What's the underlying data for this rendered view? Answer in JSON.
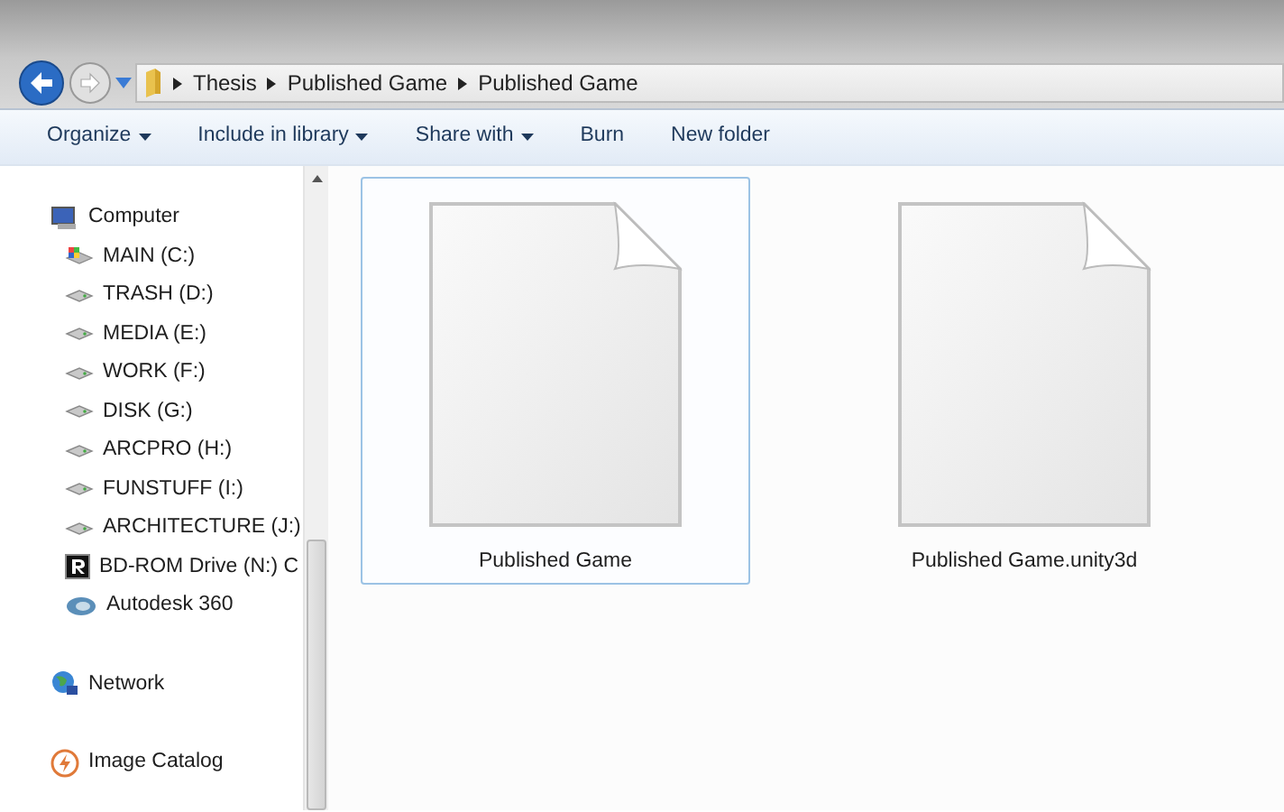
{
  "breadcrumb": {
    "segments": [
      "Thesis",
      "Published Game",
      "Published Game"
    ]
  },
  "toolbar": [
    {
      "label": "Organize",
      "dropdown": true
    },
    {
      "label": "Include in library",
      "dropdown": true
    },
    {
      "label": "Share with",
      "dropdown": true
    },
    {
      "label": "Burn",
      "dropdown": false
    },
    {
      "label": "New folder",
      "dropdown": false
    }
  ],
  "sidebar": {
    "items": [
      {
        "label": "Computer",
        "kind": "computer",
        "children": [
          {
            "label": "MAIN (C:)",
            "kind": "system-drive"
          },
          {
            "label": "TRASH (D:)",
            "kind": "drive"
          },
          {
            "label": "MEDIA (E:)",
            "kind": "drive"
          },
          {
            "label": "WORK (F:)",
            "kind": "drive"
          },
          {
            "label": "DISK (G:)",
            "kind": "drive"
          },
          {
            "label": "ARCPRO (H:)",
            "kind": "drive"
          },
          {
            "label": "FUNSTUFF (I:)",
            "kind": "drive"
          },
          {
            "label": "ARCHITECTURE (J:)",
            "kind": "drive"
          },
          {
            "label": "BD-ROM Drive (N:) C",
            "kind": "disc"
          },
          {
            "label": "Autodesk 360",
            "kind": "cloud"
          }
        ]
      },
      {
        "label": "Network",
        "kind": "network"
      },
      {
        "label": "Image Catalog",
        "kind": "catalog"
      }
    ]
  },
  "files": [
    {
      "name": "Published Game",
      "selected": true
    },
    {
      "name": "Published Game.unity3d",
      "selected": false
    }
  ]
}
